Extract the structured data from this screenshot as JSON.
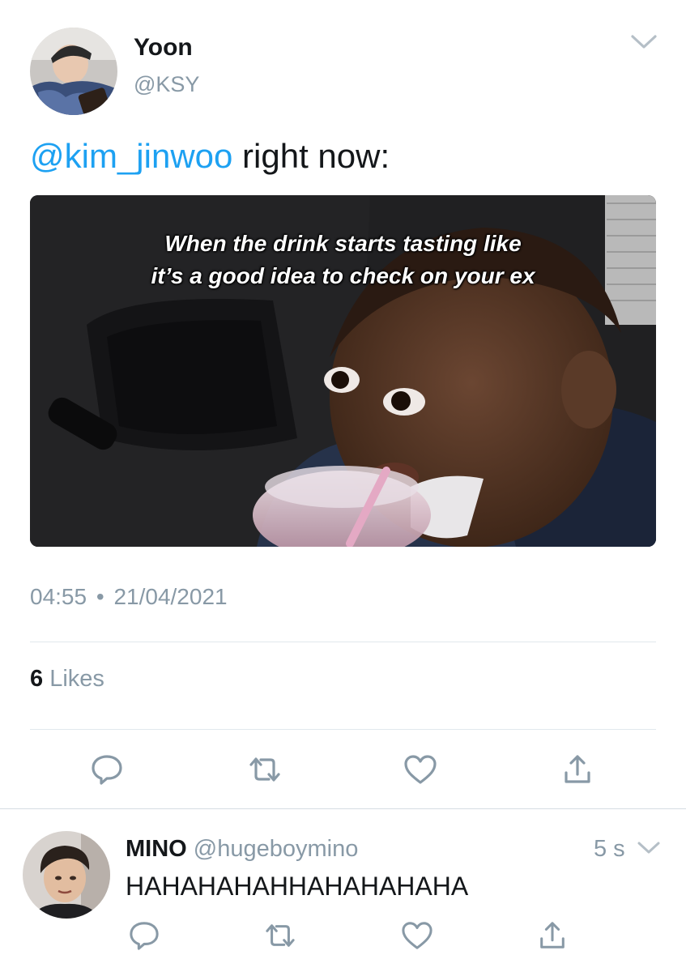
{
  "tweet": {
    "author_name": "Yoon",
    "author_handle": "@KSY",
    "mention": "@kim_jinwoo",
    "text_rest": " right now:",
    "meme_caption_line1": "When the drink starts tasting like",
    "meme_caption_line2": "it’s a good idea to check on your ex",
    "time": "04:55",
    "separator": "•",
    "date": "21/04/2021",
    "likes_count": "6",
    "likes_label": "Likes"
  },
  "reply": {
    "author_name": "MINO",
    "author_handle": "@hugeboymino",
    "time_ago": "5 s",
    "text": "HAHAHAHAHHAHAHAHAHA"
  },
  "colors": {
    "accent": "#1da1f2",
    "muted": "#8899a6",
    "text": "#14171a",
    "divider": "#e1e8ed"
  },
  "icons": {
    "actions": [
      "reply-icon",
      "retweet-icon",
      "like-icon",
      "share-icon"
    ],
    "menu": "chevron-down-icon"
  }
}
